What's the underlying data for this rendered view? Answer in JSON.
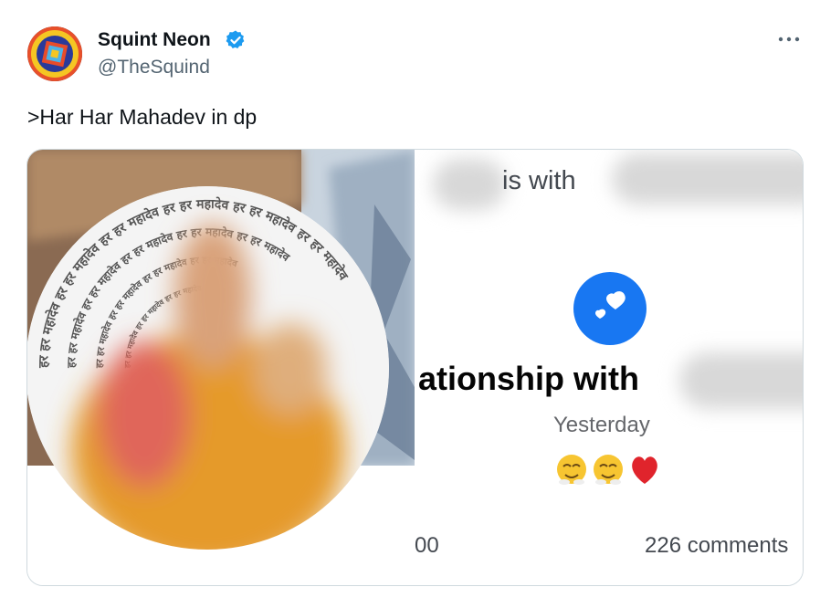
{
  "tweet": {
    "author": {
      "display_name": "Squint Neon",
      "handle": "@TheSquind",
      "verified": true,
      "verified_color": "#1d9bf0"
    },
    "text": ">Har Har Mahadev in dp",
    "more_icon": "more-horizontal-icon"
  },
  "media": {
    "profile_photo_ring_text": "हर हर महादेव",
    "fb_post": {
      "tagline": "is with",
      "relationship_text": "ationship with",
      "time": "Yesterday",
      "reaction_count": "00",
      "comments": "226 comments",
      "heart_icon": "hearts-icon",
      "reaction_icons": [
        "relieved-face-icon",
        "relieved-face-icon",
        "red-heart-icon"
      ],
      "accent_color": "#1877f2"
    }
  }
}
